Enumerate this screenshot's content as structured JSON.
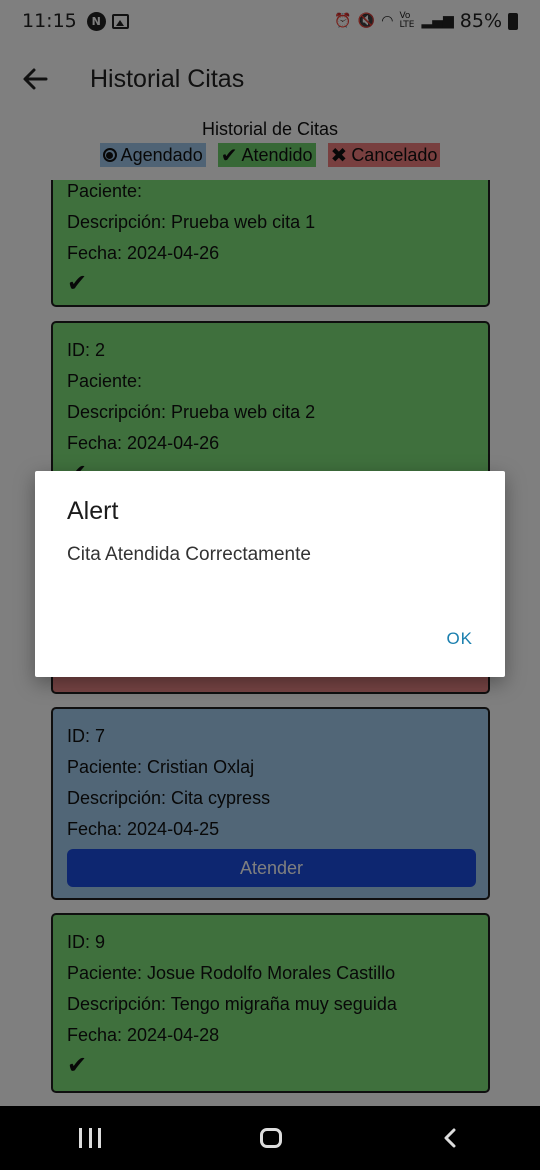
{
  "status_bar": {
    "time": "11:15",
    "battery": "85%",
    "signal_text": "Vo LTE"
  },
  "app_bar": {
    "title": "Historial Citas"
  },
  "legend": {
    "title": "Historial de Citas",
    "agendado": "Agendado",
    "atendido": "Atendido",
    "cancelado": "Cancelado",
    "colors": {
      "agendado": "#9fc7ea",
      "atendido": "#6fd06c",
      "cancelado": "#f07e7e"
    }
  },
  "cards": [
    {
      "status": "atendido",
      "paciente": "Paciente:",
      "descripcion": "Descripción: Prueba web cita 1",
      "fecha": "Fecha: 2024-04-26",
      "check": "✔"
    },
    {
      "status": "atendido",
      "id": "ID: 2",
      "paciente": "Paciente:",
      "descripcion": "Descripción: Prueba web cita 2",
      "fecha": "Fecha: 2024-04-26",
      "check": "✔"
    },
    {
      "status": "cancelado"
    },
    {
      "status": "agendado",
      "id": "ID: 7",
      "paciente": "Paciente: Cristian Oxlaj",
      "descripcion": "Descripción: Cita cypress",
      "fecha": "Fecha: 2024-04-25",
      "button": "Atender"
    },
    {
      "status": "atendido",
      "id": "ID: 9",
      "paciente": "Paciente: Josue Rodolfo Morales Castillo",
      "descripcion": "Descripción: Tengo migraña muy seguida",
      "fecha": "Fecha: 2024-04-28",
      "check": "✔"
    }
  ],
  "dialog": {
    "title": "Alert",
    "message": "Cita Atendida Correctamente",
    "ok": "OK"
  }
}
